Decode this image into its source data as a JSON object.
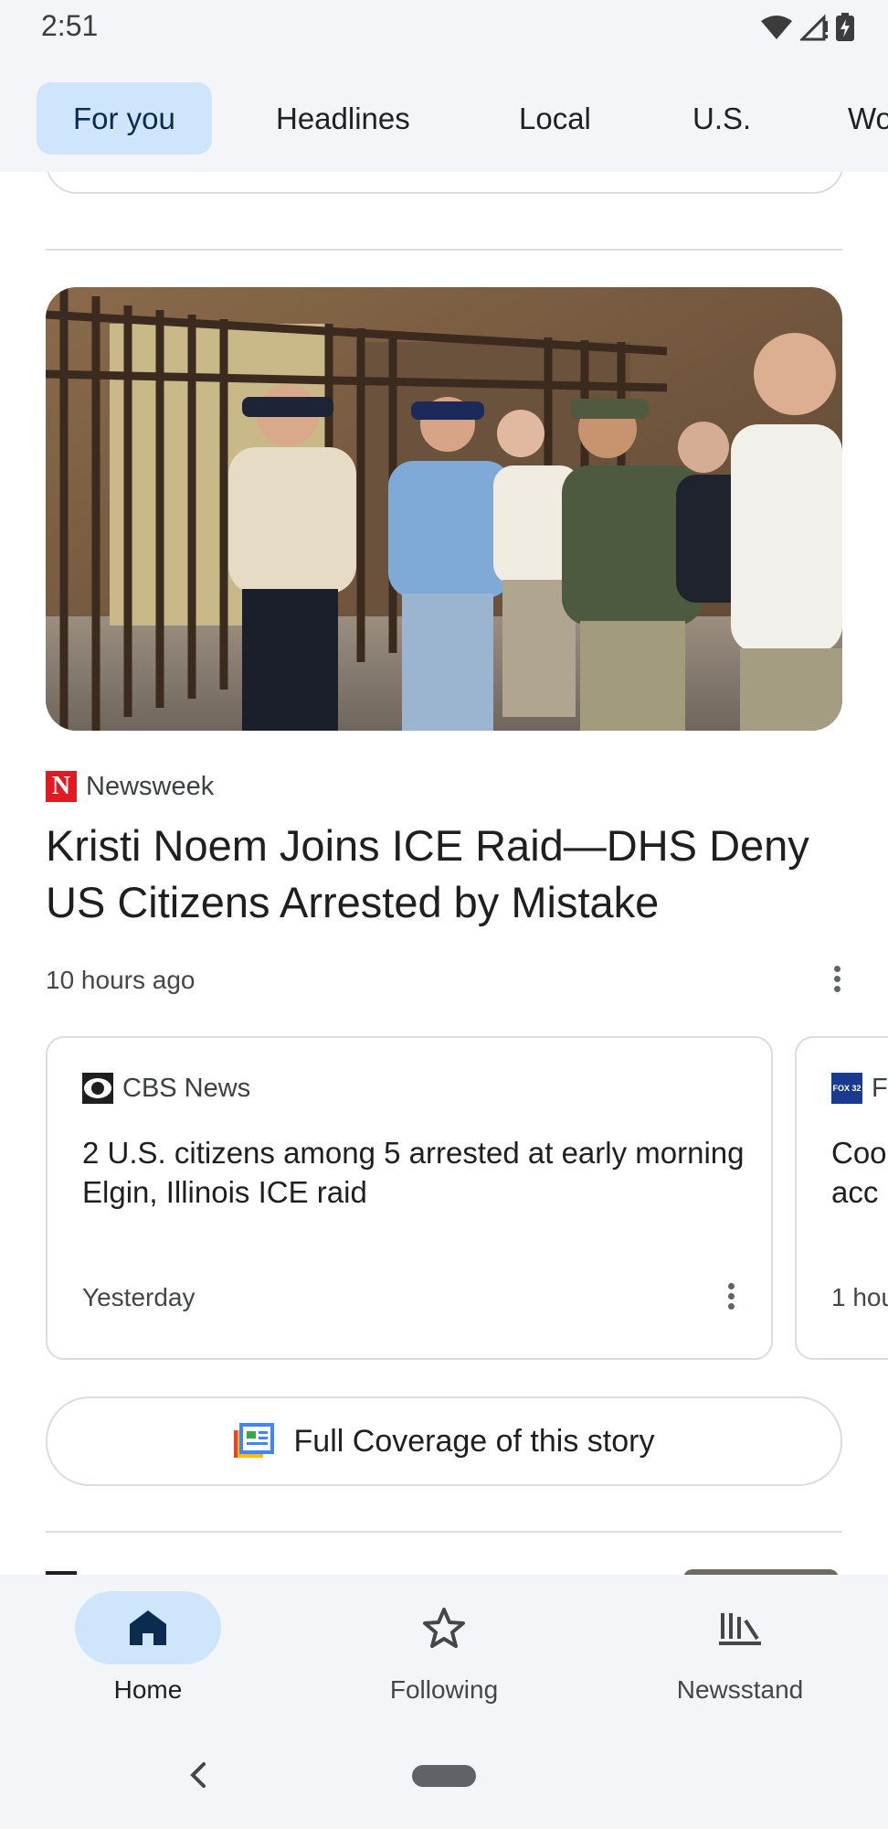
{
  "status_bar": {
    "time": "2:51",
    "icons": [
      "wifi-icon",
      "signal-icon",
      "battery-charging-icon"
    ]
  },
  "tabs": [
    {
      "label": "For you",
      "active": true
    },
    {
      "label": "Headlines",
      "active": false
    },
    {
      "label": "Local",
      "active": false
    },
    {
      "label": "U.S.",
      "active": false
    },
    {
      "label": "Wo",
      "active": false
    }
  ],
  "story": {
    "source": "Newsweek",
    "source_logo_letter": "N",
    "headline": "Kristi Noem Joins ICE Raid—DHS Deny US Citizens Arrested by Mistake",
    "time": "10 hours ago"
  },
  "related_cards": [
    {
      "source": "CBS News",
      "title": "2 U.S. citizens among 5 arrested at early morning Elgin, Illinois ICE raid",
      "time": "Yesterday"
    },
    {
      "source": "F",
      "logo_text": "FOX 32",
      "title": "Coo acc",
      "time": "1 hou"
    }
  ],
  "coverage_button": {
    "label": "Full Coverage of this story"
  },
  "bottom_nav": [
    {
      "label": "Home",
      "icon": "home-icon",
      "active": true
    },
    {
      "label": "Following",
      "icon": "star-icon",
      "active": false
    },
    {
      "label": "Newsstand",
      "icon": "newsstand-icon",
      "active": false
    }
  ],
  "colors": {
    "accent": "#cfe5fb",
    "background": "#f3f5f9",
    "newsweek_red": "#e01a22",
    "fox_blue": "#1a3a8f"
  }
}
